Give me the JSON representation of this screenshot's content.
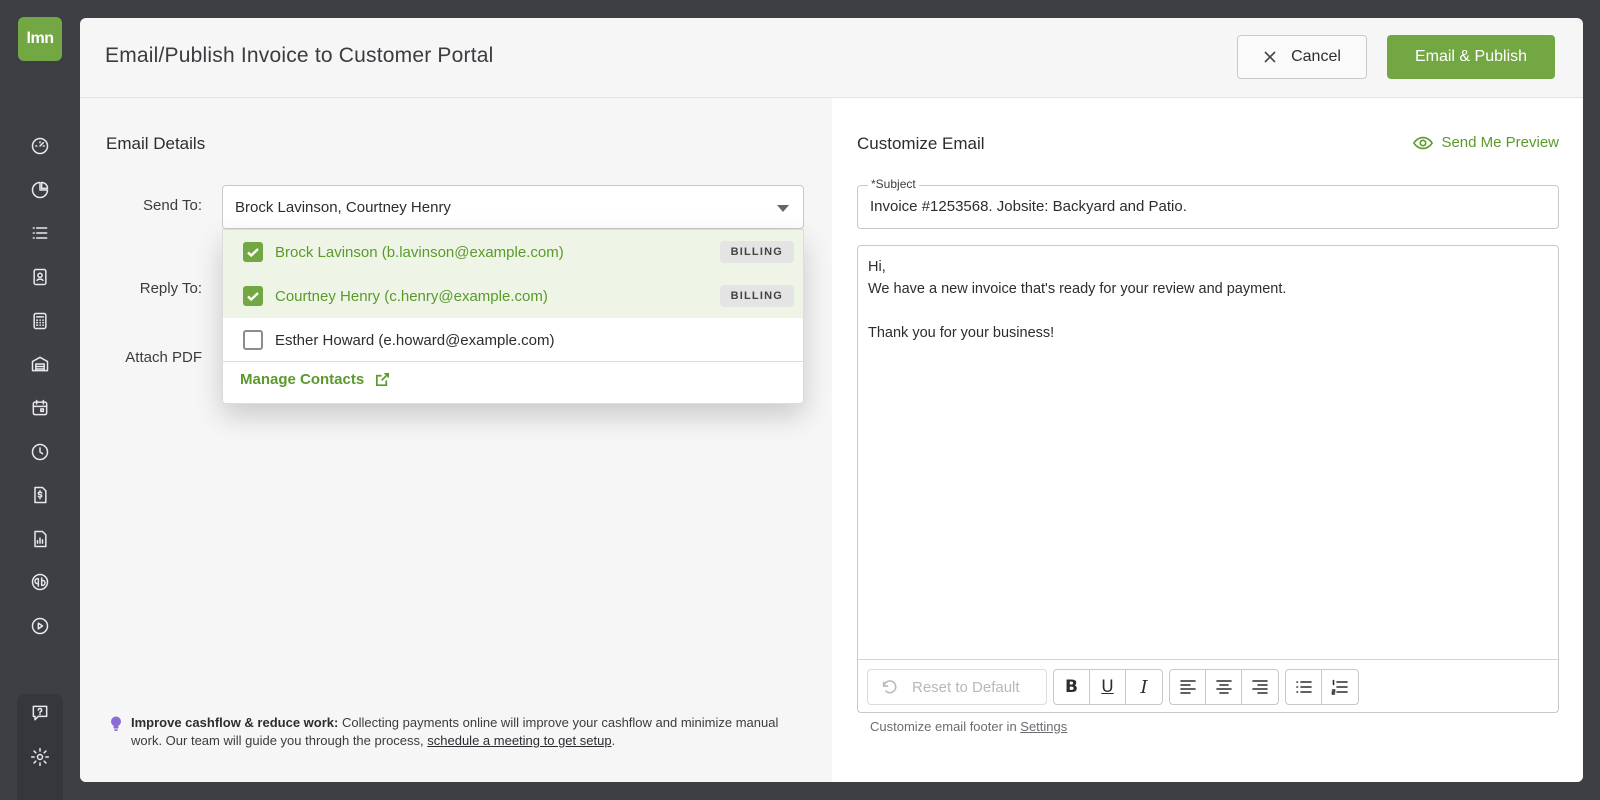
{
  "app": {
    "logo_text": "lmn",
    "brand_color": "#72a743"
  },
  "sidebar": {
    "items": [
      {
        "name": "dashboard-icon"
      },
      {
        "name": "pie-chart-icon"
      },
      {
        "name": "list-icon"
      },
      {
        "name": "contact-card-icon"
      },
      {
        "name": "calculator-icon"
      },
      {
        "name": "warehouse-icon"
      },
      {
        "name": "calendar-icon"
      },
      {
        "name": "clock-icon"
      },
      {
        "name": "invoice-dollar-icon"
      },
      {
        "name": "report-chart-icon"
      },
      {
        "name": "quickbooks-icon"
      },
      {
        "name": "play-icon"
      }
    ],
    "bottom": [
      {
        "name": "help-chat-icon"
      },
      {
        "name": "settings-gear-icon"
      }
    ]
  },
  "modal": {
    "title": "Email/Publish Invoice to Customer Portal",
    "cancel_label": "Cancel",
    "publish_label": "Email & Publish"
  },
  "email_details": {
    "title": "Email Details",
    "send_to_label": "Send To:",
    "send_to_value": "Brock Lavinson, Courtney Henry",
    "reply_to_label": "Reply To:",
    "attach_pdf_label": "Attach PDF",
    "contacts": [
      {
        "text": "Brock Lavinson (b.lavinson@example.com)",
        "badge": "BILLING",
        "checked": true
      },
      {
        "text": "Courtney Henry  (c.henry@example.com)",
        "badge": "BILLING",
        "checked": true
      },
      {
        "text": "Esther Howard (e.howard@example.com)",
        "badge": "",
        "checked": false
      }
    ],
    "manage_contacts_label": "Manage Contacts"
  },
  "tip": {
    "bold": "Improve cashflow & reduce work:",
    "text": " Collecting payments online will improve your cashflow and minimize manual work. Our team will guide you through the process, ",
    "link": "schedule a meeting to get setup",
    "end": "."
  },
  "customize_email": {
    "title": "Customize Email",
    "preview_label": "Send Me Preview",
    "subject_label": "*Subject",
    "subject_value": "Invoice #1253568. Jobsite: Backyard and Patio.",
    "body_lines": [
      "Hi,",
      "We have a new invoice that's ready for your review and payment.",
      "",
      "Thank you for your business!"
    ],
    "reset_label": "Reset to Default",
    "footer_text": "Customize email footer in ",
    "footer_link": "Settings"
  }
}
